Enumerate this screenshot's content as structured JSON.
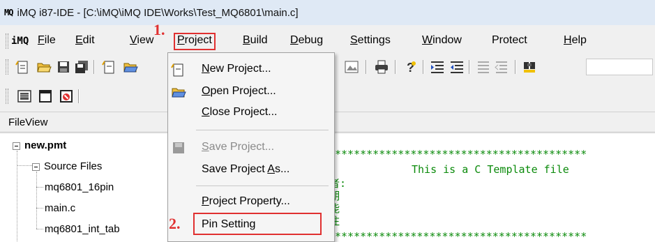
{
  "window": {
    "logo": "MQ",
    "title": "iMQ i87-IDE - [C:\\iMQ\\iMQ IDE\\Works\\Test_MQ6801\\main.c]"
  },
  "menubar": {
    "logo": "iMQ",
    "items": [
      {
        "label": "File",
        "underline": 0
      },
      {
        "label": "Edit",
        "underline": 0
      },
      {
        "label": "View",
        "underline": 0
      },
      {
        "label": "Project",
        "underline": 0,
        "active": true
      },
      {
        "label": "Build",
        "underline": 0
      },
      {
        "label": "Debug",
        "underline": 0
      },
      {
        "label": "Settings",
        "underline": 0
      },
      {
        "label": "Window",
        "underline": 0
      },
      {
        "label": "Protect",
        "underline": -1
      },
      {
        "label": "Help",
        "underline": 0
      }
    ]
  },
  "fileview": {
    "title": "FileView",
    "root": "new.pmt",
    "folder": "Source Files",
    "files": [
      "mq6801_16pin",
      "main.c",
      "mq6801_int_tab"
    ]
  },
  "editor": {
    "stars": "****************************************",
    "template_line": "This is a C Template file",
    "side_chars": [
      "者:",
      "期",
      "能",
      "注"
    ]
  },
  "project_menu": {
    "items": [
      {
        "label": "New Project...",
        "underline": 0,
        "icon": "new-project-icon",
        "enabled": true
      },
      {
        "label": "Open Project...",
        "underline": 0,
        "icon": "open-folder-icon",
        "enabled": true
      },
      {
        "label": "Close Project...",
        "underline": 0,
        "icon": "",
        "enabled": true
      },
      {
        "label": "Save Project...",
        "underline": 0,
        "icon": "save-project-icon",
        "enabled": false
      },
      {
        "label": "Save Project As...",
        "underline": 13,
        "icon": "",
        "enabled": true
      },
      {
        "label": "Project Property...",
        "underline": 0,
        "icon": "",
        "enabled": true
      },
      {
        "label": "Pin Setting",
        "underline": -1,
        "icon": "",
        "enabled": true
      }
    ]
  },
  "annotations": {
    "step1": "1.",
    "step2": "2."
  },
  "colors": {
    "annotation_red": "#e03030",
    "code_green": "#0a8a0a",
    "titlebar_bg": "#dfe9f5"
  }
}
